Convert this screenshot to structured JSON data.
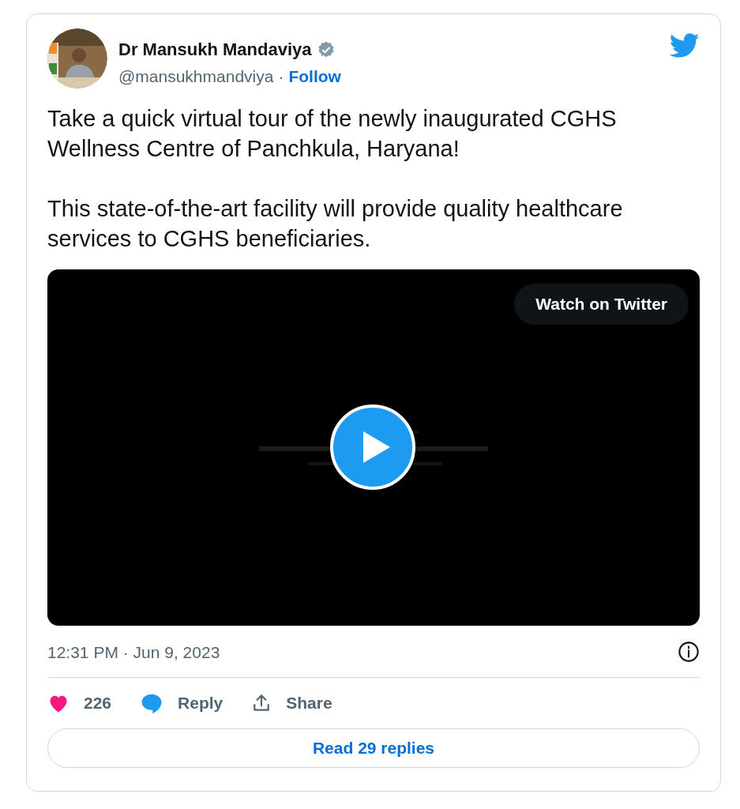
{
  "author": {
    "name": "Dr Mansukh Mandaviya",
    "verified": true,
    "handle": "@mansukhmandviya",
    "separator": "·",
    "follow": "Follow"
  },
  "paragraphs": [
    "Take a quick virtual tour of the newly inaugurated CGHS Wellness Centre of Panchkula, Haryana!",
    "This state-of-the-art facility will provide quality healthcare services to CGHS beneficiaries."
  ],
  "video": {
    "kind": "picture",
    "watch_label": "Watch on Twitter"
  },
  "timestamp": "12:31 PM · Jun 9, 2023",
  "actions": [
    {
      "kind": "like",
      "label": "226"
    },
    {
      "kind": "reply",
      "label": "Reply"
    },
    {
      "kind": "share",
      "label": "Share"
    }
  ],
  "read_replies": "Read 29 replies"
}
